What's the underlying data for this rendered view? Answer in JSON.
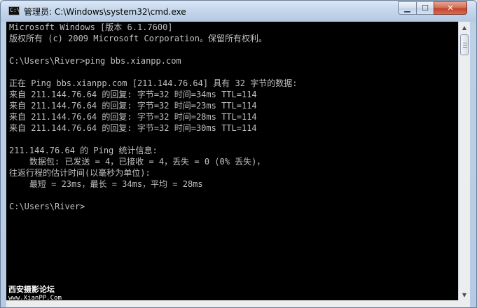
{
  "window": {
    "title": "管理员: C:\\Windows\\system32\\cmd.exe",
    "icon": "cmd-window-icon",
    "icon_glyph": "C:\\",
    "controls": {
      "minimize_glyph": "▁",
      "maximize_glyph": "☐",
      "close_glyph": "✕"
    }
  },
  "console": {
    "text": "Microsoft Windows [版本 6.1.7600]\n版权所有 (c) 2009 Microsoft Corporation。保留所有权利。\n\nC:\\Users\\River>ping bbs.xianpp.com\n\n正在 Ping bbs.xianpp.com [211.144.76.64] 具有 32 字节的数据:\n来自 211.144.76.64 的回复: 字节=32 时间=34ms TTL=114\n来自 211.144.76.64 的回复: 字节=32 时间=23ms TTL=114\n来自 211.144.76.64 的回复: 字节=32 时间=28ms TTL=114\n来自 211.144.76.64 的回复: 字节=32 时间=30ms TTL=114\n\n211.144.76.64 的 Ping 统计信息:\n    数据包: 已发送 = 4，已接收 = 4，丢失 = 0 (0% 丢失)，\n往返行程的估计时间(以毫秒为单位):\n    最短 = 23ms，最长 = 34ms，平均 = 28ms\n\nC:\\Users\\River>"
  },
  "scrollbar": {
    "up_glyph": "▲",
    "down_glyph": "▼"
  },
  "watermark": {
    "line1": "西安摄影论坛",
    "line2": "www.XianPP.Com"
  },
  "colors": {
    "console_bg": "#000000",
    "console_fg": "#c0c0c0",
    "close_button": "#c2452b"
  }
}
